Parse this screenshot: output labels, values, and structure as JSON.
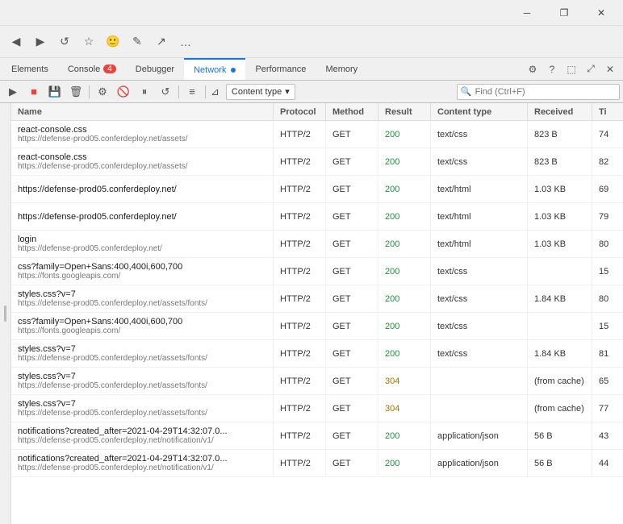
{
  "window": {
    "title_buttons": {
      "minimize": "─",
      "maximize": "□",
      "close": "✕"
    }
  },
  "browser_toolbar": {
    "icons": [
      "◀",
      "▶",
      "↺",
      "☆",
      "⬡",
      "✎",
      "↑",
      "…"
    ]
  },
  "devtools_tabs": {
    "items": [
      {
        "id": "elements",
        "label": "Elements",
        "badge": null,
        "active": false
      },
      {
        "id": "console",
        "label": "Console",
        "badge": "4",
        "badge_type": "error",
        "active": false
      },
      {
        "id": "debugger",
        "label": "Debugger",
        "badge": null,
        "active": false
      },
      {
        "id": "network",
        "label": "Network",
        "badge": null,
        "dot": true,
        "active": true
      },
      {
        "id": "performance",
        "label": "Performance",
        "badge": null,
        "active": false
      },
      {
        "id": "memory",
        "label": "Memory",
        "badge": null,
        "active": false
      }
    ]
  },
  "network_toolbar": {
    "filter_placeholder": "Find (Ctrl+F)",
    "content_type_label": "Content type",
    "buttons": [
      {
        "id": "record",
        "icon": "▶",
        "active": false
      },
      {
        "id": "stop",
        "icon": "■",
        "active": true
      },
      {
        "id": "save",
        "icon": "💾",
        "active": false
      },
      {
        "id": "clear",
        "icon": "🗑",
        "active": false
      },
      {
        "id": "filter2",
        "icon": "⚙",
        "active": false
      },
      {
        "id": "block",
        "icon": "🚫",
        "active": false
      },
      {
        "id": "pause",
        "icon": "⏸",
        "active": false
      },
      {
        "id": "reload",
        "icon": "↺",
        "active": false
      },
      {
        "id": "settings",
        "icon": "≡",
        "active": false
      }
    ]
  },
  "table": {
    "headers": [
      "Name",
      "Protocol",
      "Method",
      "Result",
      "Content type",
      "Received",
      "Ti"
    ],
    "rows": [
      {
        "name": "react-console.css",
        "url": "https://defense-prod05.conferdeploy.net/assets/",
        "protocol": "HTTP/2",
        "method": "GET",
        "result": "200",
        "result_class": "result-200",
        "content_type": "text/css",
        "received": "823 B",
        "time": "74"
      },
      {
        "name": "react-console.css",
        "url": "https://defense-prod05.conferdeploy.net/assets/",
        "protocol": "HTTP/2",
        "method": "GET",
        "result": "200",
        "result_class": "result-200",
        "content_type": "text/css",
        "received": "823 B",
        "time": "82"
      },
      {
        "name": "https://defense-prod05.conferdeploy.net/",
        "url": "",
        "protocol": "HTTP/2",
        "method": "GET",
        "result": "200",
        "result_class": "result-200",
        "content_type": "text/html",
        "received": "1.03 KB",
        "time": "69"
      },
      {
        "name": "https://defense-prod05.conferdeploy.net/",
        "url": "",
        "protocol": "HTTP/2",
        "method": "GET",
        "result": "200",
        "result_class": "result-200",
        "content_type": "text/html",
        "received": "1.03 KB",
        "time": "79"
      },
      {
        "name": "login",
        "url": "https://defense-prod05.conferdeploy.net/",
        "protocol": "HTTP/2",
        "method": "GET",
        "result": "200",
        "result_class": "result-200",
        "content_type": "text/html",
        "received": "1.03 KB",
        "time": "80"
      },
      {
        "name": "css?family=Open+Sans:400,400i,600,700",
        "url": "https://fonts.googleapis.com/",
        "protocol": "HTTP/2",
        "method": "GET",
        "result": "200",
        "result_class": "result-200",
        "content_type": "text/css",
        "received": "",
        "time": "15"
      },
      {
        "name": "styles.css?v=7",
        "url": "https://defense-prod05.conferdeploy.net/assets/fonts/",
        "protocol": "HTTP/2",
        "method": "GET",
        "result": "200",
        "result_class": "result-200",
        "content_type": "text/css",
        "received": "1.84 KB",
        "time": "80"
      },
      {
        "name": "css?family=Open+Sans:400,400i,600,700",
        "url": "https://fonts.googleapis.com/",
        "protocol": "HTTP/2",
        "method": "GET",
        "result": "200",
        "result_class": "result-200",
        "content_type": "text/css",
        "received": "",
        "time": "15"
      },
      {
        "name": "styles.css?v=7",
        "url": "https://defense-prod05.conferdeploy.net/assets/fonts/",
        "protocol": "HTTP/2",
        "method": "GET",
        "result": "200",
        "result_class": "result-200",
        "content_type": "text/css",
        "received": "1.84 KB",
        "time": "81"
      },
      {
        "name": "styles.css?v=7",
        "url": "https://defense-prod05.conferdeploy.net/assets/fonts/",
        "protocol": "HTTP/2",
        "method": "GET",
        "result": "304",
        "result_class": "result-304",
        "content_type": "",
        "received": "(from cache)",
        "time": "65"
      },
      {
        "name": "styles.css?v=7",
        "url": "https://defense-prod05.conferdeploy.net/assets/fonts/",
        "protocol": "HTTP/2",
        "method": "GET",
        "result": "304",
        "result_class": "result-304",
        "content_type": "",
        "received": "(from cache)",
        "time": "77"
      },
      {
        "name": "notifications?created_after=2021-04-29T14:32:07.0...",
        "url": "https://defense-prod05.conferdeploy.net/notification/v1/",
        "protocol": "HTTP/2",
        "method": "GET",
        "result": "200",
        "result_class": "result-200",
        "content_type": "application/json",
        "received": "56 B",
        "time": "43"
      },
      {
        "name": "notifications?created_after=2021-04-29T14:32:07.0...",
        "url": "https://defense-prod05.conferdeploy.net/notification/v1/",
        "protocol": "HTTP/2",
        "method": "GET",
        "result": "200",
        "result_class": "result-200",
        "content_type": "application/json",
        "received": "56 B",
        "time": "44"
      }
    ]
  }
}
